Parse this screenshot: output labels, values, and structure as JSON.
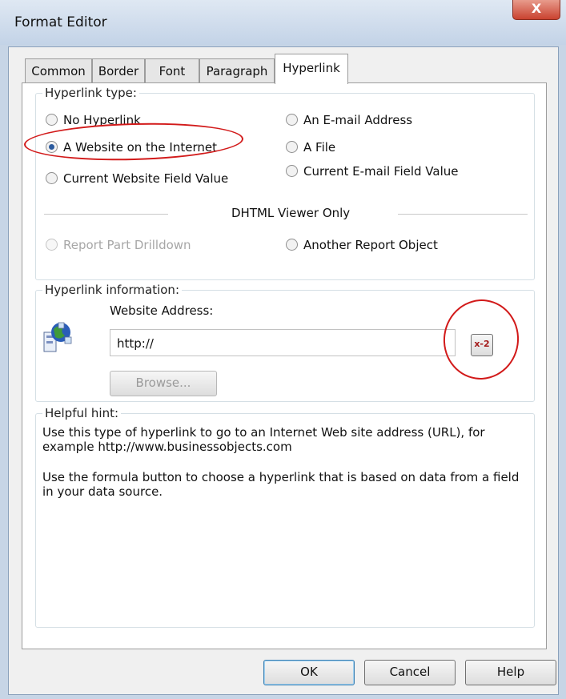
{
  "window": {
    "title": "Format Editor",
    "close_label": "X"
  },
  "tabs": [
    {
      "label": "Common"
    },
    {
      "label": "Border"
    },
    {
      "label": "Font"
    },
    {
      "label": "Paragraph"
    },
    {
      "label": "Hyperlink"
    }
  ],
  "hyperlink_type": {
    "label": "Hyperlink type:",
    "options": [
      {
        "label": "No Hyperlink"
      },
      {
        "label": "A Website on the Internet"
      },
      {
        "label": "Current Website Field Value"
      },
      {
        "label": "An E-mail Address"
      },
      {
        "label": "A File"
      },
      {
        "label": "Current E-mail Field Value"
      }
    ],
    "dhtml_label": "DHTML Viewer Only",
    "dhtml_options": [
      {
        "label": "Report Part Drilldown"
      },
      {
        "label": "Another Report Object"
      }
    ]
  },
  "hyperlink_info": {
    "label": "Hyperlink information:",
    "address_label": "Website Address:",
    "address_value": "http://",
    "formula_label": "x-2",
    "browse_label": "Browse..."
  },
  "hint": {
    "label": "Helpful hint:",
    "line1": "Use this type of hyperlink to go to an Internet Web site address (URL), for",
    "line2": "example http://www.businessobjects.com",
    "line3": "Use the formula button to choose a hyperlink that is based on data from a field",
    "line4": "in your data source."
  },
  "buttons": {
    "ok": "OK",
    "cancel": "Cancel",
    "help": "Help"
  },
  "colors": {
    "annotation": "#d21a1a",
    "selected_radio": "#2c5b9e"
  }
}
